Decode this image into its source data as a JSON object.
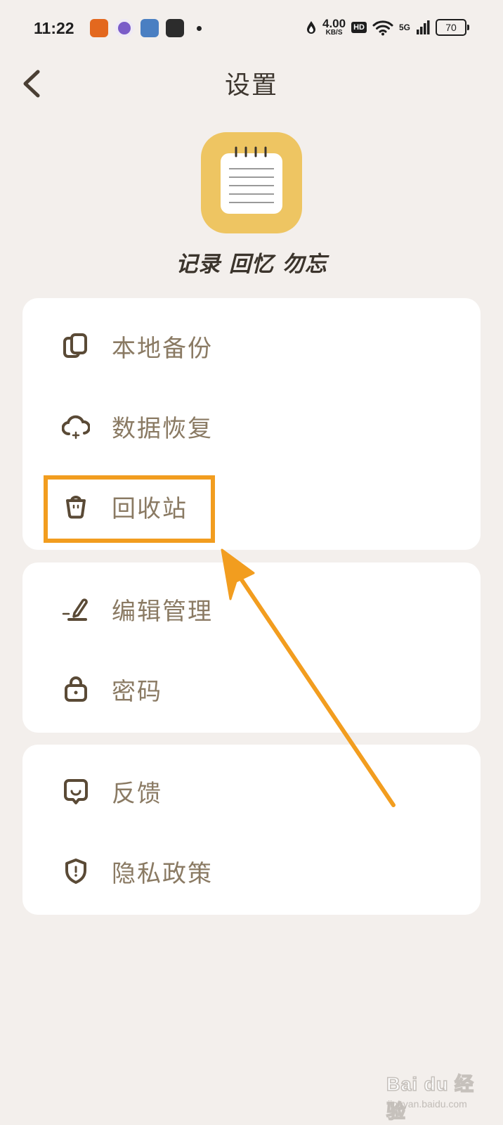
{
  "status_bar": {
    "time": "11:22",
    "net_speed": "4.00",
    "net_unit": "KB/S",
    "hd": "HD",
    "network": "5G",
    "battery": "70"
  },
  "header": {
    "title": "设置"
  },
  "logo": {
    "slogan": "记录 回忆 勿忘",
    "accent_color": "#eec562"
  },
  "menu": {
    "group1": [
      {
        "label": "本地备份",
        "icon": "copy-icon"
      },
      {
        "label": "数据恢复",
        "icon": "cloud-restore-icon"
      },
      {
        "label": "回收站",
        "icon": "trash-icon"
      }
    ],
    "group2": [
      {
        "label": "编辑管理",
        "icon": "pen-icon"
      },
      {
        "label": "密码",
        "icon": "lock-icon"
      }
    ],
    "group3": [
      {
        "label": "反馈",
        "icon": "feedback-icon"
      },
      {
        "label": "隐私政策",
        "icon": "shield-icon"
      }
    ],
    "label_color": "#8a7a63",
    "icon_color": "#5a4a36"
  },
  "annotation": {
    "color": "#f29d1f"
  },
  "watermark": {
    "main": "Bai du 经验",
    "sub": "jingyan.baidu.com"
  }
}
